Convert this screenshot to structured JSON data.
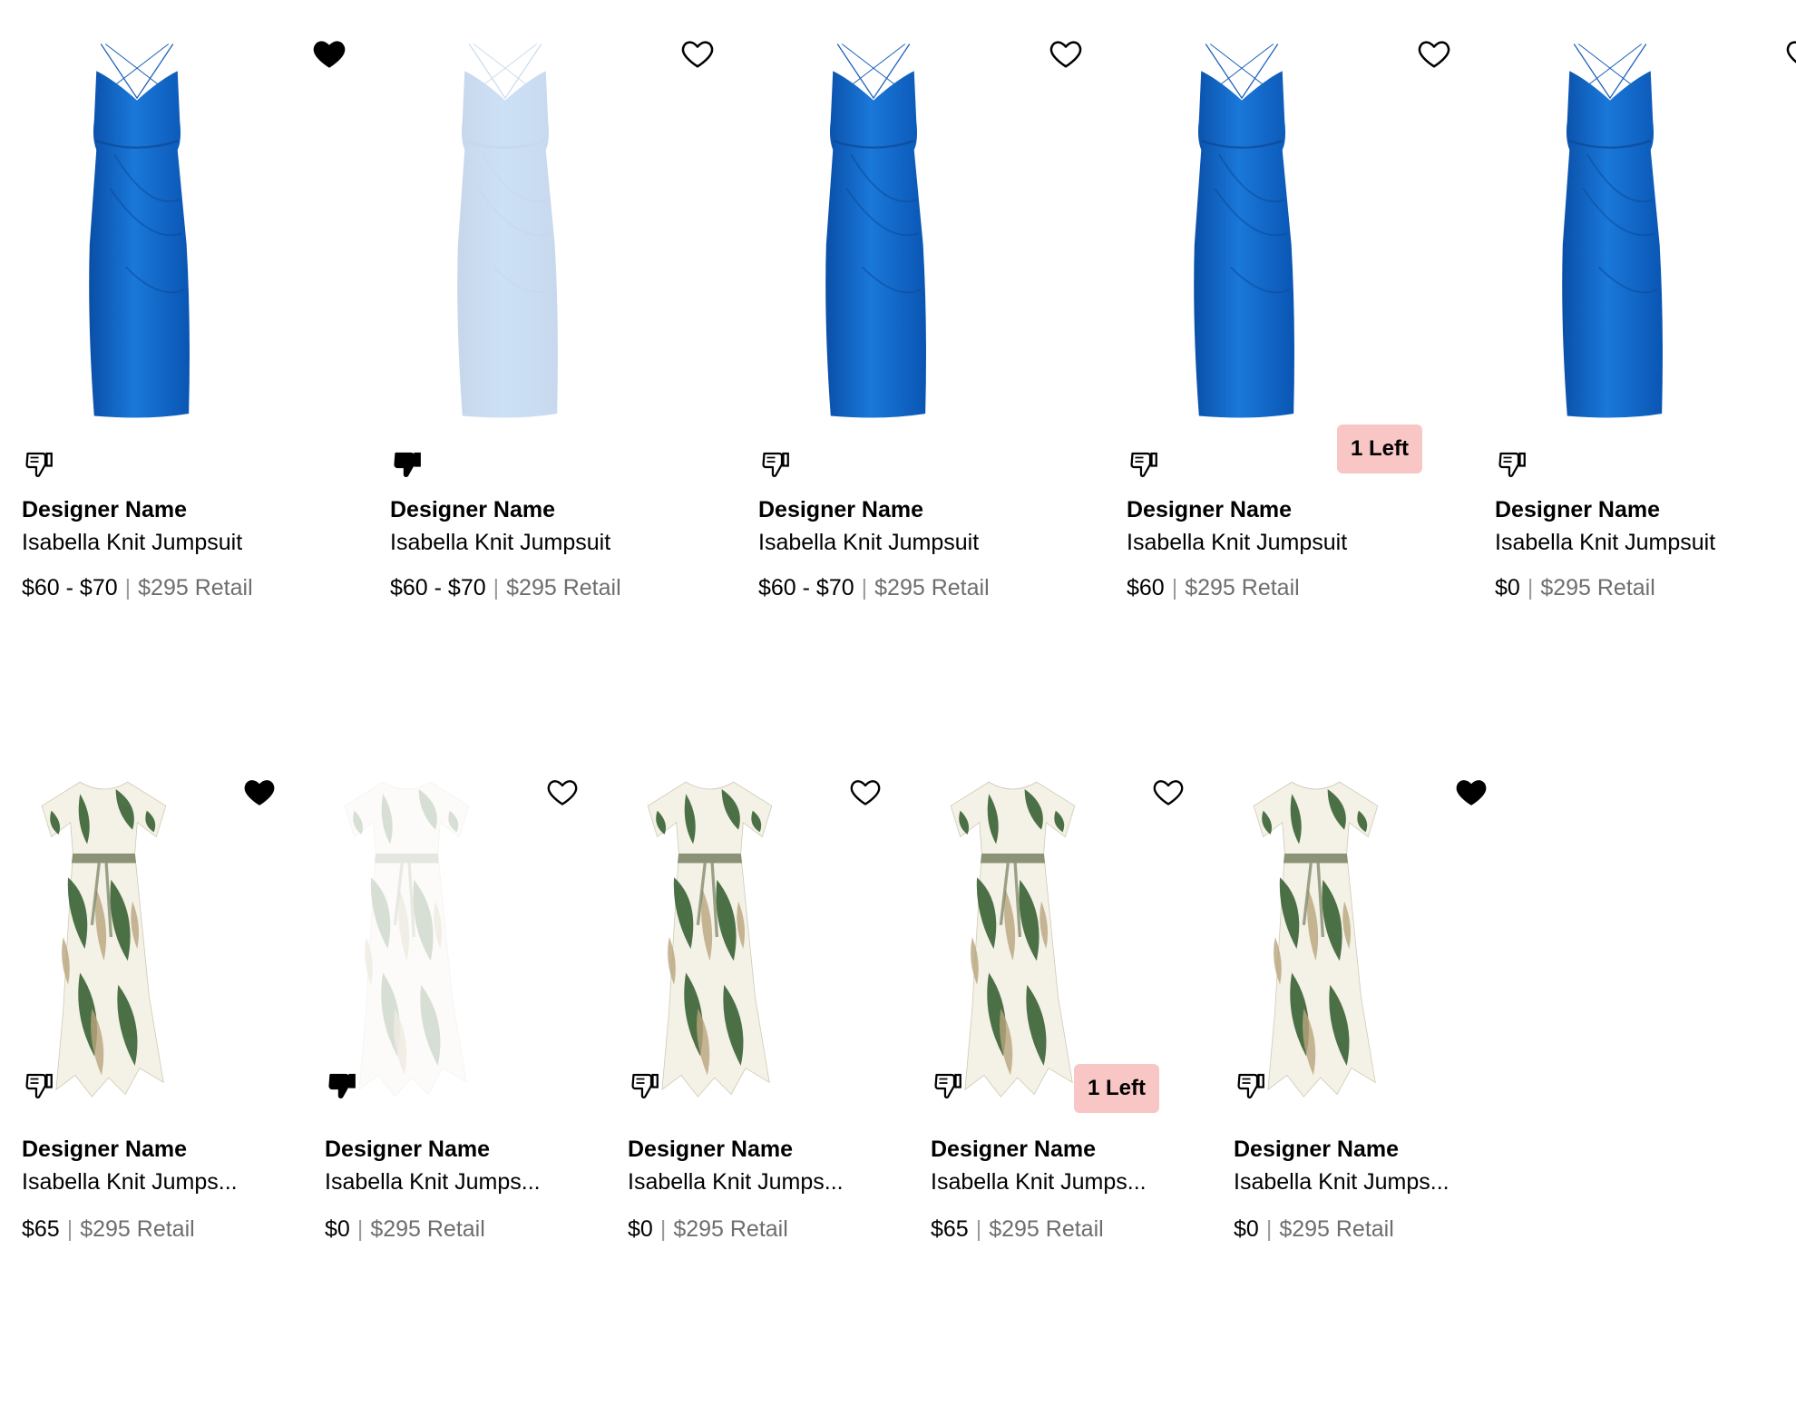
{
  "colors": {
    "accent_blue": "#0b63c4",
    "badge_pink": "#f9c6c6",
    "retail_grey": "#6e6e6e"
  },
  "rows": [
    {
      "items": [
        {
          "dress": "blue",
          "faded": false,
          "favorited": true,
          "thumbs_down": false,
          "badge": "",
          "designer": "Designer Name",
          "product": "Isabella Knit Jumpsuit",
          "price": "$60 - $70",
          "retail": "$295 Retail"
        },
        {
          "dress": "blue",
          "faded": true,
          "favorited": false,
          "thumbs_down": true,
          "badge": "",
          "designer": "Designer Name",
          "product": "Isabella Knit Jumpsuit",
          "price": "$60 - $70",
          "retail": "$295 Retail"
        },
        {
          "dress": "blue",
          "faded": false,
          "favorited": false,
          "thumbs_down": false,
          "badge": "",
          "designer": "Designer Name",
          "product": "Isabella Knit Jumpsuit",
          "price": "$60 - $70",
          "retail": "$295 Retail"
        },
        {
          "dress": "blue",
          "faded": false,
          "favorited": false,
          "thumbs_down": false,
          "badge": "1 Left",
          "designer": "Designer Name",
          "product": "Isabella Knit Jumpsuit",
          "price": "$60",
          "retail": "$295 Retail"
        },
        {
          "dress": "blue",
          "faded": false,
          "favorited": false,
          "thumbs_down": false,
          "badge": "",
          "designer": "Designer Name",
          "product": "Isabella Knit Jumpsuit",
          "price": "$0",
          "retail": "$295 Retail"
        }
      ]
    },
    {
      "items": [
        {
          "dress": "floral",
          "faded": false,
          "favorited": true,
          "thumbs_down": false,
          "badge": "",
          "designer": "Designer Name",
          "product": "Isabella Knit Jumps...",
          "price": "$65",
          "retail": "$295 Retail"
        },
        {
          "dress": "floral",
          "faded": true,
          "favorited": false,
          "thumbs_down": true,
          "badge": "",
          "designer": "Designer Name",
          "product": "Isabella Knit Jumps...",
          "price": "$0",
          "retail": "$295 Retail"
        },
        {
          "dress": "floral",
          "faded": false,
          "favorited": false,
          "thumbs_down": false,
          "badge": "",
          "designer": "Designer Name",
          "product": "Isabella Knit Jumps...",
          "price": "$0",
          "retail": "$295 Retail"
        },
        {
          "dress": "floral",
          "faded": false,
          "favorited": false,
          "thumbs_down": false,
          "badge": "1 Left",
          "designer": "Designer Name",
          "product": "Isabella Knit Jumps...",
          "price": "$65",
          "retail": "$295 Retail"
        },
        {
          "dress": "floral",
          "faded": false,
          "favorited": true,
          "thumbs_down": false,
          "badge": "",
          "designer": "Designer Name",
          "product": "Isabella Knit Jumps...",
          "price": "$0",
          "retail": "$295 Retail"
        }
      ]
    }
  ]
}
